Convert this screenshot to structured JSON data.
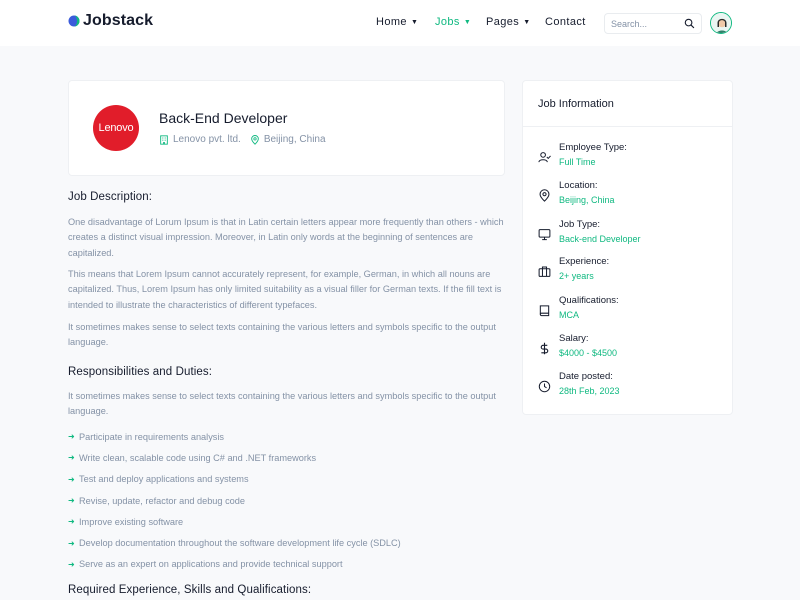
{
  "brand": {
    "name": "Jobstack",
    "accent": "#10b981"
  },
  "nav": [
    {
      "label": "Home",
      "has_caret": true
    },
    {
      "label": "Jobs",
      "has_caret": true,
      "active": true
    },
    {
      "label": "Pages",
      "has_caret": true
    },
    {
      "label": "Contact",
      "has_caret": false
    }
  ],
  "search": {
    "placeholder": "Search..."
  },
  "job": {
    "company_logo_text": "Lenovo",
    "title": "Back-End Developer",
    "company": "Lenovo pvt. ltd.",
    "location": "Beijing, China"
  },
  "description": {
    "heading": "Job Description:",
    "paragraphs": [
      "One disadvantage of Lorum Ipsum is that in Latin certain letters appear more frequently than others - which creates a distinct visual impression. Moreover, in Latin only words at the beginning of sentences are capitalized.",
      "This means that Lorem Ipsum cannot accurately represent, for example, German, in which all nouns are capitalized. Thus, Lorem Ipsum has only limited suitability as a visual filler for German texts. If the fill text is intended to illustrate the characteristics of different typefaces.",
      "It sometimes makes sense to select texts containing the various letters and symbols specific to the output language."
    ]
  },
  "responsibilities": {
    "heading": "Responsibilities and Duties:",
    "intro": "It sometimes makes sense to select texts containing the various letters and symbols specific to the output language.",
    "items": [
      "Participate in requirements analysis",
      "Write clean, scalable code using C# and .NET frameworks",
      "Test and deploy applications and systems",
      "Revise, update, refactor and debug code",
      "Improve existing software",
      "Develop documentation throughout the software development life cycle (SDLC)",
      "Serve as an expert on applications and provide technical support"
    ]
  },
  "requirements": {
    "heading": "Required Experience, Skills and Qualifications:"
  },
  "job_info": {
    "heading": "Job Information",
    "items": [
      {
        "icon": "user-check-icon",
        "label": "Employee Type:",
        "value": "Full Time"
      },
      {
        "icon": "map-pin-icon",
        "label": "Location:",
        "value": "Beijing, China"
      },
      {
        "icon": "monitor-icon",
        "label": "Job Type:",
        "value": "Back-end Developer"
      },
      {
        "icon": "briefcase-icon",
        "label": "Experience:",
        "value": "2+ years"
      },
      {
        "icon": "book-icon",
        "label": "Qualifications:",
        "value": "MCA"
      },
      {
        "icon": "dollar-icon",
        "label": "Salary:",
        "value": "$4000 - $4500"
      },
      {
        "icon": "clock-icon",
        "label": "Date posted:",
        "value": "28th Feb, 2023"
      }
    ]
  }
}
